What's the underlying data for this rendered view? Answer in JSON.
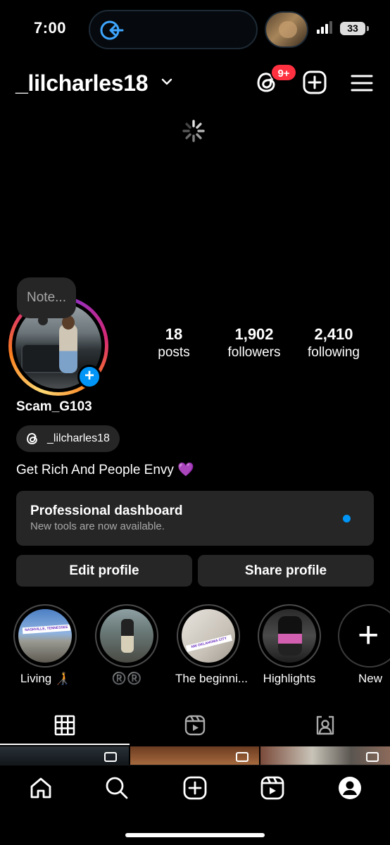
{
  "status_bar": {
    "time": "7:00",
    "battery": "33"
  },
  "header": {
    "username": "_lilcharles18",
    "notification_badge": "9+"
  },
  "profile": {
    "note_placeholder": "Note...",
    "display_name": "Scam_G103",
    "threads_handle": "_lilcharles18",
    "bio": "Get Rich And People Envy 💜",
    "stats": [
      {
        "value": "18",
        "label": "posts"
      },
      {
        "value": "1,902",
        "label": "followers"
      },
      {
        "value": "2,410",
        "label": "following"
      }
    ]
  },
  "professional_dashboard": {
    "title": "Professional dashboard",
    "subtitle": "New tools are now available."
  },
  "actions": {
    "edit_profile": "Edit profile",
    "share_profile": "Share profile"
  },
  "highlights": [
    {
      "label": "Living 🧑‍🦯",
      "sticker": "NASHVILLE, TENNESSEE"
    },
    {
      "label": "®️®️"
    },
    {
      "label": "The beginni...",
      "sticker": "NW OKLAHOMA CITY"
    },
    {
      "label": "Highlights"
    },
    {
      "label": "New"
    }
  ],
  "tabs": [
    "grid-tab",
    "reels-tab",
    "tagged-tab"
  ],
  "bottom_nav": [
    "home",
    "search",
    "create",
    "reels",
    "profile"
  ],
  "colors": {
    "accent": "#0095f6",
    "badge": "#ff3040",
    "surface": "#262626",
    "muted": "#a8a8a8"
  }
}
